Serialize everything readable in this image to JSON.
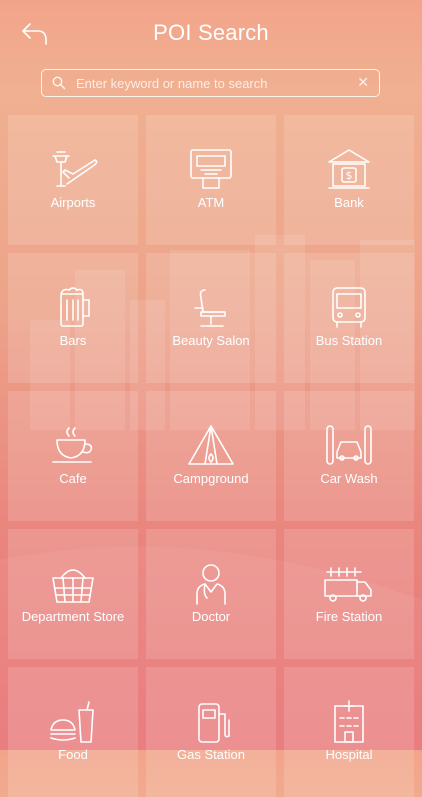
{
  "header": {
    "title": "POI Search"
  },
  "search": {
    "placeholder": "Enter keyword or name to search"
  },
  "tiles": [
    {
      "label": "Airports",
      "icon": "airport-icon"
    },
    {
      "label": "ATM",
      "icon": "atm-icon"
    },
    {
      "label": "Bank",
      "icon": "bank-icon"
    },
    {
      "label": "Bars",
      "icon": "beer-mug-icon"
    },
    {
      "label": "Beauty Salon",
      "icon": "salon-chair-icon"
    },
    {
      "label": "Bus Station",
      "icon": "bus-icon"
    },
    {
      "label": "Cafe",
      "icon": "coffee-cup-icon"
    },
    {
      "label": "Campground",
      "icon": "tent-icon"
    },
    {
      "label": "Car Wash",
      "icon": "car-wash-icon"
    },
    {
      "label": "Department Store",
      "icon": "basket-icon"
    },
    {
      "label": "Doctor",
      "icon": "doctor-icon"
    },
    {
      "label": "Fire Station",
      "icon": "fire-truck-icon"
    },
    {
      "label": "Food",
      "icon": "fast-food-icon"
    },
    {
      "label": "Gas Station",
      "icon": "gas-pump-icon"
    },
    {
      "label": "Hospital",
      "icon": "hospital-icon"
    }
  ],
  "colors": {
    "gradient_top": "#f0b091",
    "gradient_bottom": "#e87779",
    "text": "#ffffff"
  }
}
